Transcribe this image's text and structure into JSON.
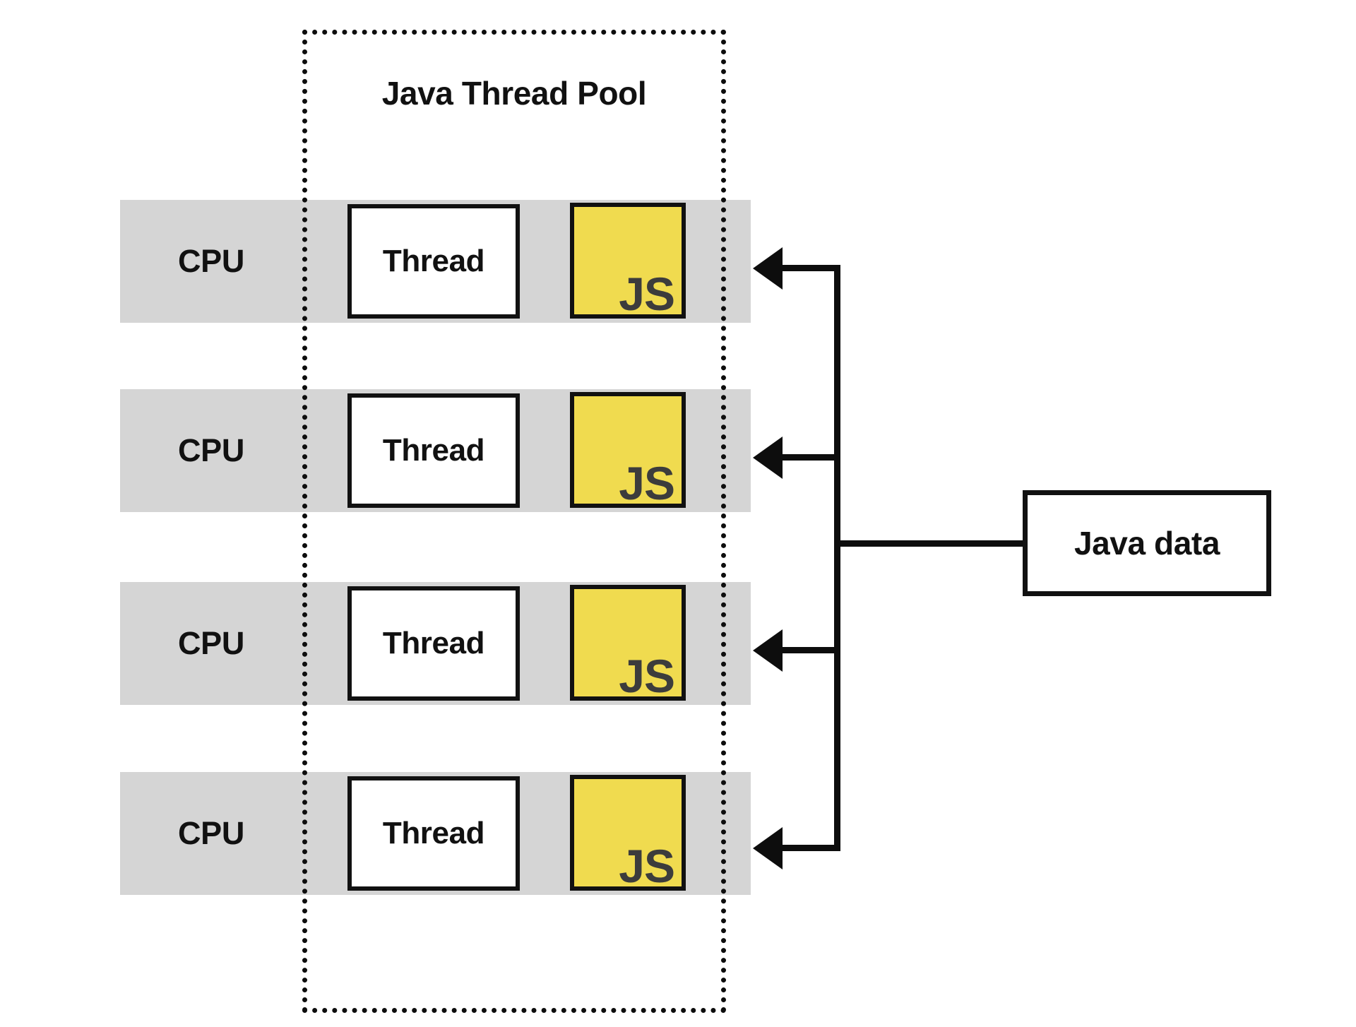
{
  "diagram": {
    "pool": {
      "title": "Java Thread Pool",
      "border_style": "dotted",
      "border_color": "#0d0d0d"
    },
    "rows": [
      {
        "cpu_label": "CPU",
        "thread_label": "Thread",
        "runtime_label": "JS"
      },
      {
        "cpu_label": "CPU",
        "thread_label": "Thread",
        "runtime_label": "JS"
      },
      {
        "cpu_label": "CPU",
        "thread_label": "Thread",
        "runtime_label": "JS"
      },
      {
        "cpu_label": "CPU",
        "thread_label": "Thread",
        "runtime_label": "JS"
      }
    ],
    "data_source": {
      "label": "Java data"
    },
    "colors": {
      "row_background": "#d5d5d5",
      "js_fill": "#f0db4f",
      "js_text": "#3c3c3c",
      "stroke": "#111111",
      "page_background": "#ffffff"
    }
  }
}
